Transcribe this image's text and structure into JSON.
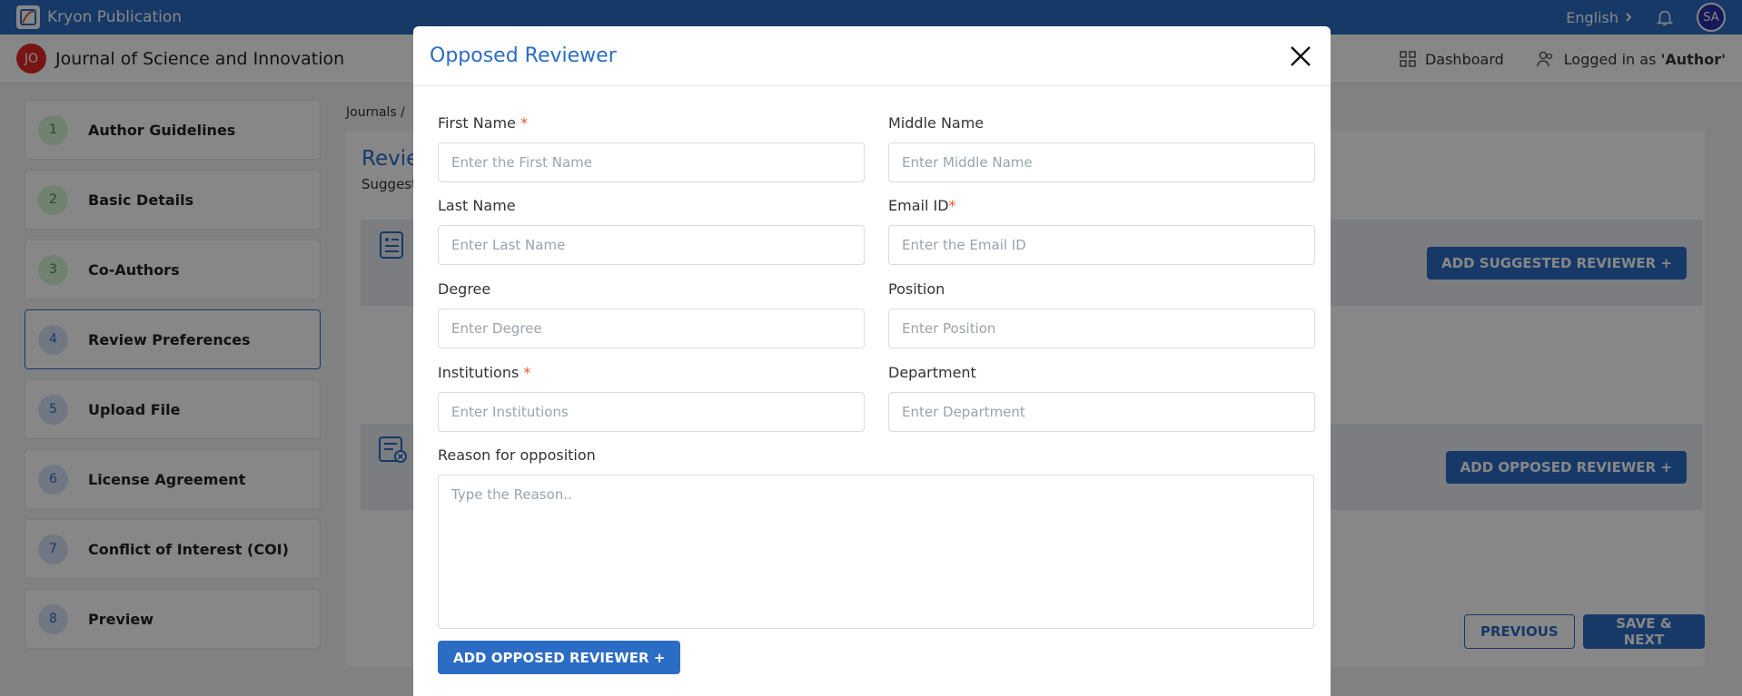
{
  "topbar": {
    "brand": "Kryon Publication",
    "language": "English",
    "avatar": "SA"
  },
  "subheader": {
    "journal_badge": "JO",
    "journal_name": "Journal of Science and Innovation",
    "dashboard": "Dashboard",
    "logged_in_prefix": "Logged in as ",
    "logged_in_role": "'Author'"
  },
  "sidebar": {
    "steps": [
      {
        "num": "1",
        "label": "Author Guidelines"
      },
      {
        "num": "2",
        "label": "Basic Details"
      },
      {
        "num": "3",
        "label": "Co-Authors"
      },
      {
        "num": "4",
        "label": "Review Preferences"
      },
      {
        "num": "5",
        "label": "Upload File"
      },
      {
        "num": "6",
        "label": "License Agreement"
      },
      {
        "num": "7",
        "label": "Conflict of Interest (COI)"
      },
      {
        "num": "8",
        "label": "Preview"
      }
    ]
  },
  "main": {
    "breadcrumb": "Journals /",
    "title": "Revie",
    "subtitle": "Suggest",
    "add_suggested": "ADD SUGGESTED REVIEWER +",
    "add_opposed": "ADD OPPOSED REVIEWER +",
    "previous": "PREVIOUS",
    "save_next": "SAVE & NEXT"
  },
  "modal": {
    "title": "Opposed Reviewer",
    "fields": {
      "first_name": {
        "label": "First Name",
        "required": "*",
        "placeholder": "Enter the First Name"
      },
      "middle_name": {
        "label": "Middle Name",
        "placeholder": "Enter Middle Name"
      },
      "last_name": {
        "label": "Last Name",
        "placeholder": "Enter Last Name"
      },
      "email": {
        "label": "Email ID",
        "required": "*",
        "placeholder": "Enter the Email ID"
      },
      "degree": {
        "label": "Degree",
        "placeholder": "Enter Degree"
      },
      "position": {
        "label": "Position",
        "placeholder": "Enter Position"
      },
      "institutions": {
        "label": "Institutions",
        "required": "*",
        "placeholder": "Enter Institutions"
      },
      "department": {
        "label": "Department",
        "placeholder": "Enter Department"
      },
      "reason": {
        "label": "Reason for opposition",
        "placeholder": "Type the Reason.."
      }
    },
    "submit": "ADD OPPOSED REVIEWER +"
  }
}
